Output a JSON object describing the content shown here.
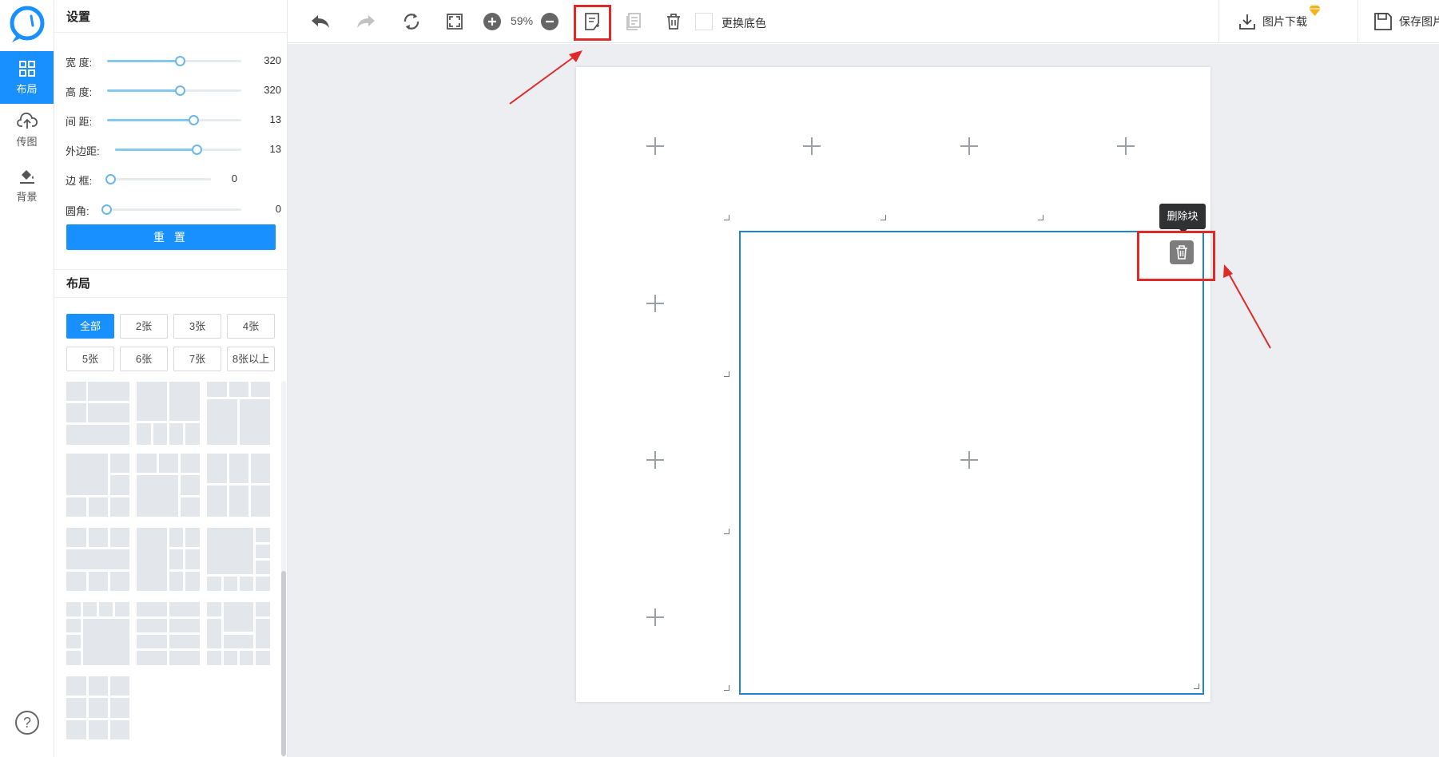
{
  "rail": {
    "items": [
      {
        "label": "布局",
        "icon": "grid-icon",
        "active": true
      },
      {
        "label": "传图",
        "icon": "upload-cloud-icon",
        "active": false
      },
      {
        "label": "背景",
        "icon": "paint-bucket-icon",
        "active": false
      }
    ],
    "help_symbol": "?"
  },
  "settings": {
    "title": "设置",
    "sliders": [
      {
        "label": "宽 度:",
        "value": "320",
        "level": 0.55
      },
      {
        "label": "高 度:",
        "value": "320",
        "level": 0.55
      },
      {
        "label": "间 距:",
        "value": "13",
        "level": 0.65
      },
      {
        "label": "外边距:",
        "value": "13",
        "level": 0.65
      },
      {
        "label": "边 框:",
        "value": "0",
        "level": 0.0
      },
      {
        "label": "圆角:",
        "value": "0",
        "level": 0.0
      }
    ],
    "border_color": "#000000",
    "reset_label": "重 置"
  },
  "layout": {
    "title": "布局",
    "filters": [
      "全部",
      "2张",
      "3张",
      "4张",
      "5张",
      "6张",
      "7张",
      "8张以上"
    ],
    "active_filter": "全部"
  },
  "toolbar": {
    "zoom": "59%",
    "bg_label": "更换底色",
    "download_label": "图片下载",
    "save_label": "保存图片"
  },
  "canvas": {
    "tooltip": "删除块"
  },
  "colors": {
    "accent": "#1890ff",
    "annotation": "#e02a2a",
    "selection": "#1d85d6"
  }
}
